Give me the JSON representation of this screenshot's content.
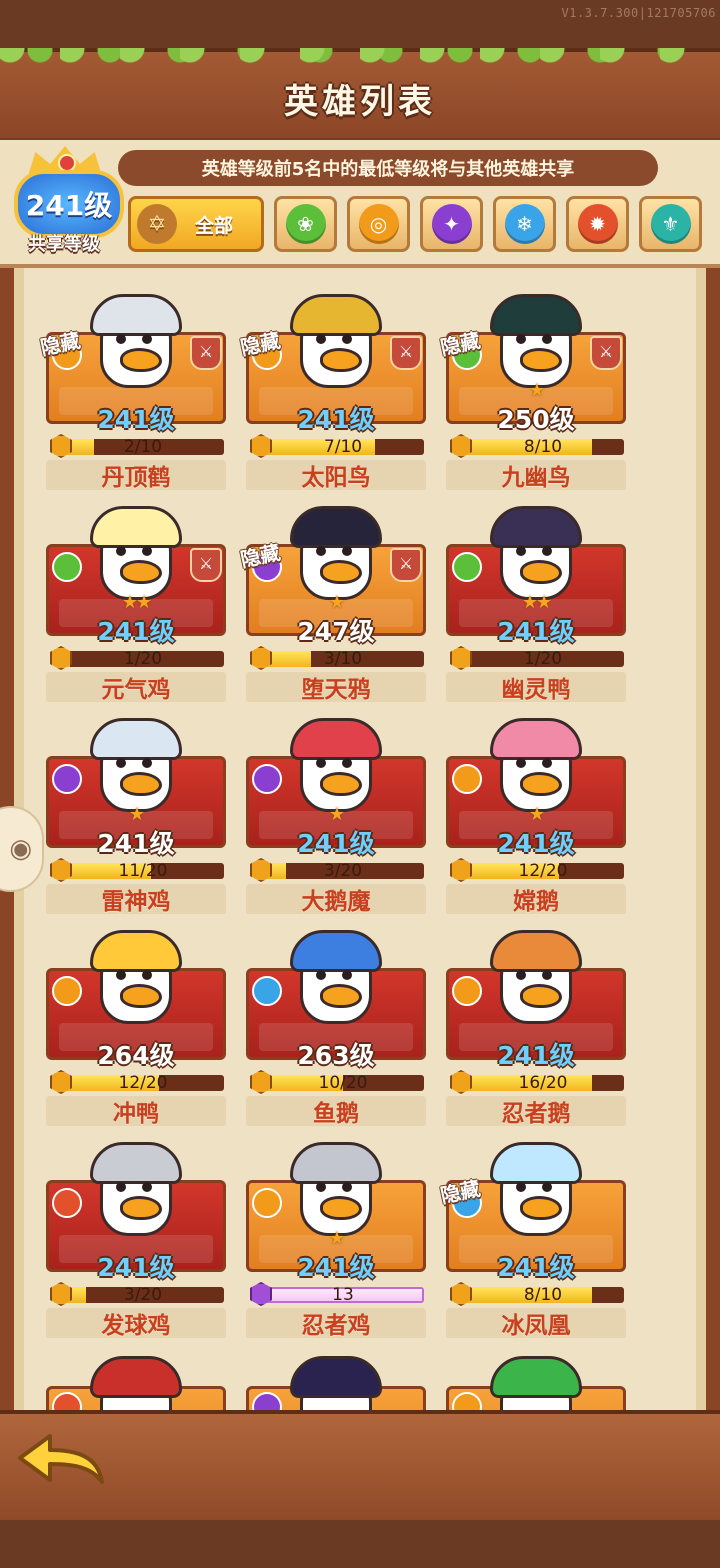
{
  "app": {
    "version": "V1.3.7.300|121705706",
    "title": "英雄列表"
  },
  "header": {
    "tip": "英雄等级前5名中的最低等级将与其他英雄共享",
    "shared_level": {
      "value": "241级",
      "label": "共享等级"
    }
  },
  "filters": {
    "all_label": "全部",
    "elements": [
      {
        "icon": "nature-element-icon",
        "color": "#5cbf3a"
      },
      {
        "icon": "light-element-icon",
        "color": "#f29a1a"
      },
      {
        "icon": "shadow-element-icon",
        "color": "#8b3fd1"
      },
      {
        "icon": "ice-element-icon",
        "color": "#3aa4e8"
      },
      {
        "icon": "fire-element-icon",
        "color": "#e2512b"
      },
      {
        "icon": "water-element-icon",
        "color": "#2bb3a6"
      }
    ]
  },
  "hidden_label": "隐藏",
  "heroes": [
    {
      "name": "丹顶鹤",
      "level": "241级",
      "progress": "2/10",
      "ratio": 0.2,
      "frame": "gold",
      "hidden": true,
      "weapon": true,
      "stars": 0,
      "level_color": "blue",
      "element": "#f29a1a"
    },
    {
      "name": "太阳鸟",
      "level": "241级",
      "progress": "7/10",
      "ratio": 0.7,
      "frame": "gold",
      "hidden": true,
      "weapon": true,
      "stars": 0,
      "level_color": "blue",
      "element": "#f29a1a"
    },
    {
      "name": "九幽鸟",
      "level": "250级",
      "progress": "8/10",
      "ratio": 0.8,
      "frame": "gold",
      "hidden": true,
      "weapon": true,
      "stars": 1,
      "level_color": "white",
      "element": "#5cbf3a"
    },
    {
      "name": "元气鸡",
      "level": "241级",
      "progress": "1/20",
      "ratio": 0.05,
      "frame": "red",
      "hidden": false,
      "weapon": true,
      "stars": 2,
      "level_color": "blue",
      "element": "#5cbf3a"
    },
    {
      "name": "堕天鸦",
      "level": "247级",
      "progress": "3/10",
      "ratio": 0.3,
      "frame": "gold",
      "hidden": true,
      "weapon": true,
      "stars": 1,
      "level_color": "white",
      "element": "#8b3fd1"
    },
    {
      "name": "幽灵鸭",
      "level": "241级",
      "progress": "1/20",
      "ratio": 0.05,
      "frame": "red",
      "hidden": false,
      "weapon": false,
      "stars": 2,
      "level_color": "blue",
      "element": "#5cbf3a"
    },
    {
      "name": "雷神鸡",
      "level": "241级",
      "progress": "11/20",
      "ratio": 0.55,
      "frame": "red",
      "hidden": false,
      "weapon": false,
      "stars": 1,
      "level_color": "white",
      "element": "#8b3fd1"
    },
    {
      "name": "大鹅魔",
      "level": "241级",
      "progress": "3/20",
      "ratio": 0.15,
      "frame": "red",
      "hidden": false,
      "weapon": false,
      "stars": 1,
      "level_color": "blue",
      "element": "#8b3fd1"
    },
    {
      "name": "嫦鹅",
      "level": "241级",
      "progress": "12/20",
      "ratio": 0.6,
      "frame": "red",
      "hidden": false,
      "weapon": false,
      "stars": 1,
      "level_color": "blue",
      "element": "#f29a1a"
    },
    {
      "name": "冲鸭",
      "level": "264级",
      "progress": "12/20",
      "ratio": 0.6,
      "frame": "red",
      "hidden": false,
      "weapon": false,
      "stars": 0,
      "level_color": "white",
      "element": "#f29a1a"
    },
    {
      "name": "鱼鹅",
      "level": "263级",
      "progress": "10/20",
      "ratio": 0.5,
      "frame": "red",
      "hidden": false,
      "weapon": false,
      "stars": 0,
      "level_color": "white",
      "element": "#3aa4e8"
    },
    {
      "name": "忍者鹅",
      "level": "241级",
      "progress": "16/20",
      "ratio": 0.8,
      "frame": "red",
      "hidden": false,
      "weapon": false,
      "stars": 0,
      "level_color": "blue",
      "element": "#f29a1a"
    },
    {
      "name": "发球鸡",
      "level": "241级",
      "progress": "3/20",
      "ratio": 0.15,
      "frame": "red",
      "hidden": false,
      "weapon": false,
      "stars": 0,
      "level_color": "blue",
      "element": "#e2512b"
    },
    {
      "name": "忍者鸡",
      "level": "241级",
      "progress": "13",
      "ratio": 1,
      "frame": "gold",
      "hidden": false,
      "weapon": false,
      "stars": 1,
      "level_color": "blue",
      "element": "#f29a1a",
      "shard": "purple"
    },
    {
      "name": "冰凤凰",
      "level": "241级",
      "progress": "8/10",
      "ratio": 0.8,
      "frame": "gold",
      "hidden": true,
      "weapon": false,
      "stars": 0,
      "level_color": "blue",
      "element": "#3aa4e8"
    }
  ],
  "partial_row": [
    {
      "frame": "gold",
      "element": "#e2512b"
    },
    {
      "frame": "gold",
      "element": "#8b3fd1"
    },
    {
      "frame": "gold",
      "element": "#f29a1a"
    }
  ],
  "footer": {
    "back_icon": "back-arrow-icon"
  }
}
